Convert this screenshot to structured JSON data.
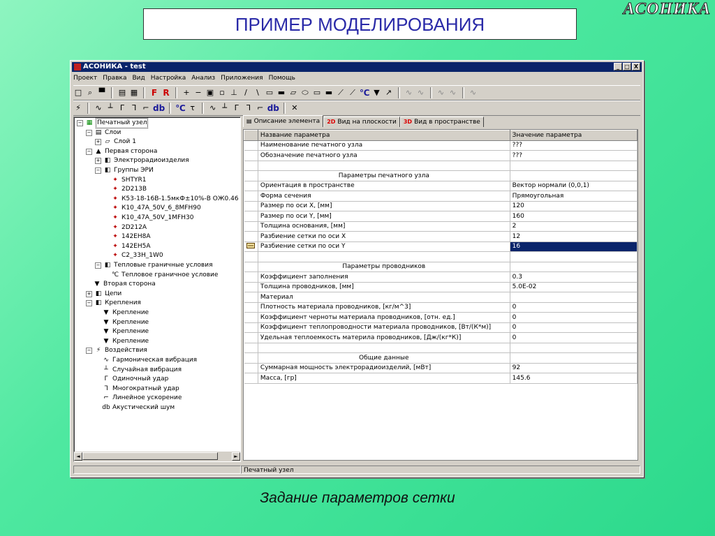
{
  "logo": "АСОНИКА",
  "slide_title": "ПРИМЕР МОДЕЛИРОВАНИЯ",
  "caption": "Задание параметров сетки",
  "window": {
    "title": "АСОНИКА - test",
    "controls": [
      "_",
      "□",
      "X"
    ],
    "menu": [
      "Проект",
      "Правка",
      "Вид",
      "Настройка",
      "Анализ",
      "Приложения",
      "Помощь"
    ]
  },
  "toolbar1": [
    "□",
    "⌕",
    "▀",
    "▤",
    "▦",
    "F",
    "R",
    "+",
    "−",
    "▣",
    "▫",
    "⊥",
    "/",
    "\\",
    "▭",
    "▬",
    "▱",
    "⬭",
    "▭",
    "▬",
    "⟋",
    "⟋",
    "℃",
    "▼",
    "↗",
    "∿",
    "∿",
    "∿",
    "∿",
    "∿"
  ],
  "toolbar2": [
    "⚡",
    "∿",
    "┴",
    "ᒥ",
    "ᒣ",
    "⌐",
    "db",
    "℃",
    "τ",
    "∿",
    "┴",
    "ᒥ",
    "ᒣ",
    "⌐",
    "db",
    "✕"
  ],
  "tree": [
    {
      "level": 0,
      "pm": "−",
      "icon": "▦",
      "icon_name": "board-icon",
      "label": "Печатный узел",
      "selected": true
    },
    {
      "level": 1,
      "pm": "−",
      "icon": "▤",
      "icon_name": "layers-icon",
      "label": "Слои"
    },
    {
      "level": 2,
      "pm": "+",
      "icon": "▱",
      "icon_name": "layer-icon",
      "label": "Слой 1"
    },
    {
      "level": 1,
      "pm": "−",
      "icon": "▲",
      "icon_name": "side-icon",
      "label": "Первая сторона"
    },
    {
      "level": 2,
      "pm": "+",
      "icon": "◧",
      "icon_name": "group-icon",
      "label": "Электрорадиоизделия"
    },
    {
      "level": 2,
      "pm": "−",
      "icon": "◧",
      "icon_name": "group-icon",
      "label": "Группы ЭРИ"
    },
    {
      "level": 3,
      "icon": "✦",
      "icon_name": "component-icon",
      "label": "SHTYR1"
    },
    {
      "level": 3,
      "icon": "✦",
      "icon_name": "component-icon",
      "label": "2D213B"
    },
    {
      "level": 3,
      "icon": "✦",
      "icon_name": "component-icon",
      "label": "К53-18-16В-1.5мкФ±10%-В ОЖ0.46"
    },
    {
      "level": 3,
      "icon": "✦",
      "icon_name": "component-icon",
      "label": "К10_47А_50V_6_8MFH90"
    },
    {
      "level": 3,
      "icon": "✦",
      "icon_name": "component-icon",
      "label": "К10_47А_50V_1MFH30"
    },
    {
      "level": 3,
      "icon": "✦",
      "icon_name": "component-icon",
      "label": "2D212A"
    },
    {
      "level": 3,
      "icon": "✦",
      "icon_name": "component-icon",
      "label": "142EH8A"
    },
    {
      "level": 3,
      "icon": "✦",
      "icon_name": "component-icon",
      "label": "142EH5A"
    },
    {
      "level": 3,
      "icon": "✦",
      "icon_name": "component-icon",
      "label": "C2_33H_1W0"
    },
    {
      "level": 2,
      "pm": "−",
      "icon": "◧",
      "icon_name": "group-icon",
      "label": "Тепловые граничные условия"
    },
    {
      "level": 3,
      "icon": "℃",
      "icon_name": "thermal-icon",
      "label": "Тепловое граничное условие"
    },
    {
      "level": 1,
      "icon": "▼",
      "icon_name": "side-icon",
      "label": "Вторая сторона"
    },
    {
      "level": 1,
      "pm": "+",
      "icon": "◧",
      "icon_name": "group-icon",
      "label": "Цепи"
    },
    {
      "level": 1,
      "pm": "−",
      "icon": "◧",
      "icon_name": "group-icon",
      "label": "Крепления"
    },
    {
      "level": 2,
      "icon": "▼",
      "icon_name": "mount-icon",
      "label": "Крепление"
    },
    {
      "level": 2,
      "icon": "▼",
      "icon_name": "mount-icon",
      "label": "Крепление"
    },
    {
      "level": 2,
      "icon": "▼",
      "icon_name": "mount-icon",
      "label": "Крепление"
    },
    {
      "level": 2,
      "icon": "▼",
      "icon_name": "mount-icon",
      "label": "Крепление"
    },
    {
      "level": 1,
      "pm": "−",
      "icon": "⚡",
      "icon_name": "impact-icon",
      "label": "Воздействия"
    },
    {
      "level": 2,
      "icon": "∿",
      "icon_name": "harmonic-icon",
      "label": "Гармоническая вибрация"
    },
    {
      "level": 2,
      "icon": "┴",
      "icon_name": "random-icon",
      "label": "Случайная вибрация"
    },
    {
      "level": 2,
      "icon": "ᒥ",
      "icon_name": "shock-icon",
      "label": "Одиночный удар"
    },
    {
      "level": 2,
      "icon": "ᒣ",
      "icon_name": "multi-shock-icon",
      "label": "Многократный удар"
    },
    {
      "level": 2,
      "icon": "⌐",
      "icon_name": "accel-icon",
      "label": "Линейное ускорение"
    },
    {
      "level": 2,
      "icon": "db",
      "icon_name": "acoustic-icon",
      "label": "Акустический шум"
    }
  ],
  "tabs": [
    {
      "icon": "▤",
      "label": "Описание элемента",
      "active": true
    },
    {
      "icon": "2D",
      "label": "Вид на плоскости"
    },
    {
      "icon": "3D",
      "label": "Вид в пространстве"
    }
  ],
  "grid": {
    "headers": [
      "Название параметра",
      "Значение параметра"
    ],
    "rows": [
      {
        "name": "Наименование печатного узла",
        "value": "???"
      },
      {
        "name": "Обозначение печатного узла",
        "value": "???"
      },
      {
        "name": "",
        "value": ""
      },
      {
        "name": "Параметры печатного узла",
        "value": "",
        "section": true
      },
      {
        "name": "Ориентация в пространстве",
        "value": "Вектор нормали (0,0,1)"
      },
      {
        "name": "Форма сечения",
        "value": "Прямоугольная"
      },
      {
        "name": "Размер по оси X, [мм]",
        "value": "120"
      },
      {
        "name": "Размер по оси Y, [мм]",
        "value": "160"
      },
      {
        "name": "Толщина основания, [мм]",
        "value": "2"
      },
      {
        "name": "Разбиение сетки по оси X",
        "value": "12"
      },
      {
        "name": "Разбиение сетки по оси Y",
        "value": "16",
        "selected": true
      },
      {
        "name": "",
        "value": ""
      },
      {
        "name": "Параметры проводников",
        "value": "",
        "section": true
      },
      {
        "name": "Коэффициент заполнения",
        "value": "0.3"
      },
      {
        "name": "Толщина проводников, [мм]",
        "value": "5.0E-02"
      },
      {
        "name": "Материал",
        "value": ""
      },
      {
        "name": "Плотность материала проводников, [кг/м^3]",
        "value": "0"
      },
      {
        "name": "Коэффициент черноты материала проводников, [отн. ед.]",
        "value": "0"
      },
      {
        "name": "Коэффициент теплопроводности материала проводников, [Вт/(К*м)]",
        "value": "0"
      },
      {
        "name": "Удельная теплоемкость материла проводников, [Дж/(кг*К)]",
        "value": "0"
      },
      {
        "name": "",
        "value": ""
      },
      {
        "name": "Общие данные",
        "value": "",
        "section": true
      },
      {
        "name": "Суммарная мощность электрорадиоизделий, [мВт]",
        "value": "92"
      },
      {
        "name": "Масса, [гр]",
        "value": "145.6"
      }
    ]
  },
  "status": [
    "",
    "Печатный узел"
  ]
}
